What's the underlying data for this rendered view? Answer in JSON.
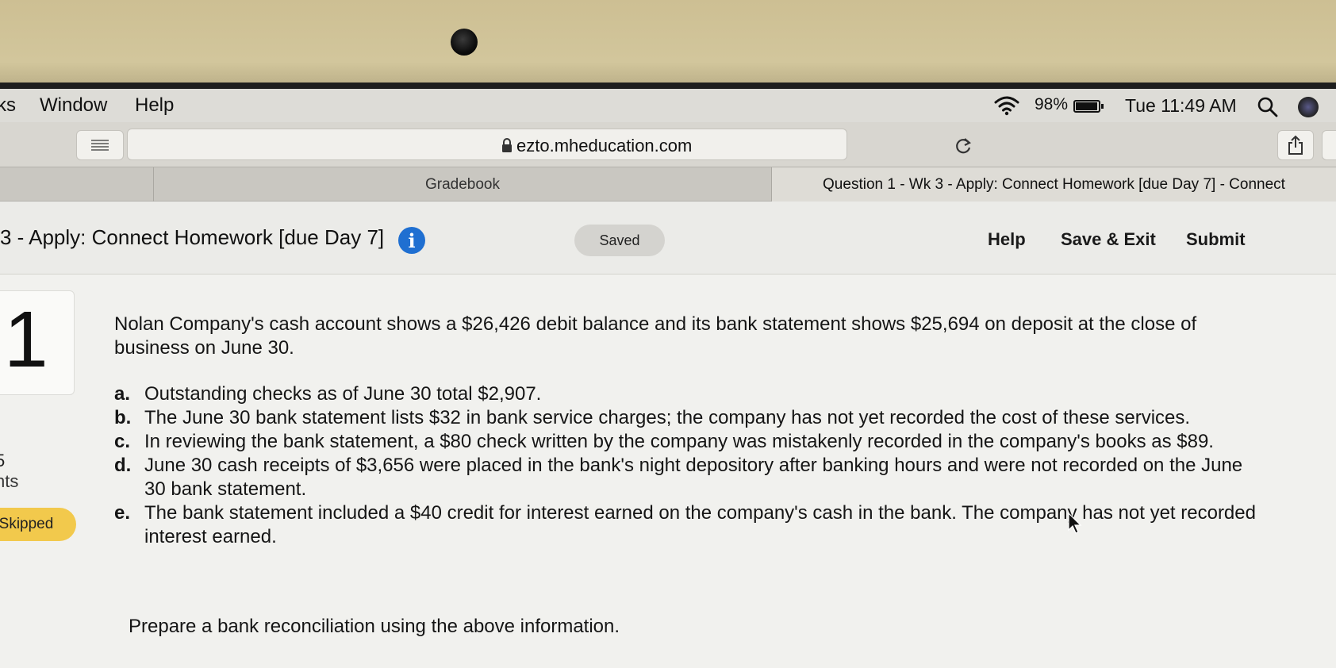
{
  "menubar": {
    "items": [
      "ks",
      "Window",
      "Help"
    ],
    "battery_pct": "98%",
    "battery_level": 0.98,
    "clock": "Tue 11:49 AM"
  },
  "browser": {
    "url": "ezto.mheducation.com",
    "tabs": [
      {
        "label": "Gradebook",
        "active": false
      },
      {
        "label": "Question 1 - Wk 3 - Apply: Connect Homework [due Day 7] - Connect",
        "active": true
      }
    ]
  },
  "app": {
    "title": "3 - Apply: Connect Homework [due Day 7]",
    "status": "Saved",
    "help": "Help",
    "save_exit": "Save & Exit",
    "submit": "Submit"
  },
  "sidebar": {
    "question_number": "1",
    "points_value": "5",
    "points_label": "nts",
    "status": "Skipped"
  },
  "question": {
    "intro": "Nolan Company's cash account shows a $26,426 debit balance and its bank statement shows $25,694 on deposit at the close of business on June 30.",
    "items": [
      {
        "letter": "a.",
        "text": "Outstanding checks as of June 30 total $2,907."
      },
      {
        "letter": "b.",
        "text": "The June 30 bank statement lists $32 in bank service charges; the company has not yet recorded the cost of these services."
      },
      {
        "letter": "c.",
        "text": "In reviewing the bank statement, a $80 check written by the company was mistakenly recorded in the company's books as $89."
      },
      {
        "letter": "d.",
        "text": "June 30 cash receipts of $3,656 were placed in the bank's night depository after banking hours and were not recorded on the June 30 bank statement."
      },
      {
        "letter": "e.",
        "text": "The bank statement included a $40 credit for interest earned on the company's cash in the bank. The company has not yet recorded interest earned."
      }
    ],
    "prompt": "Prepare a bank reconciliation using the above information."
  },
  "colors": {
    "info_blue": "#1f6fd1",
    "skipped_yellow": "#f2c94c"
  }
}
